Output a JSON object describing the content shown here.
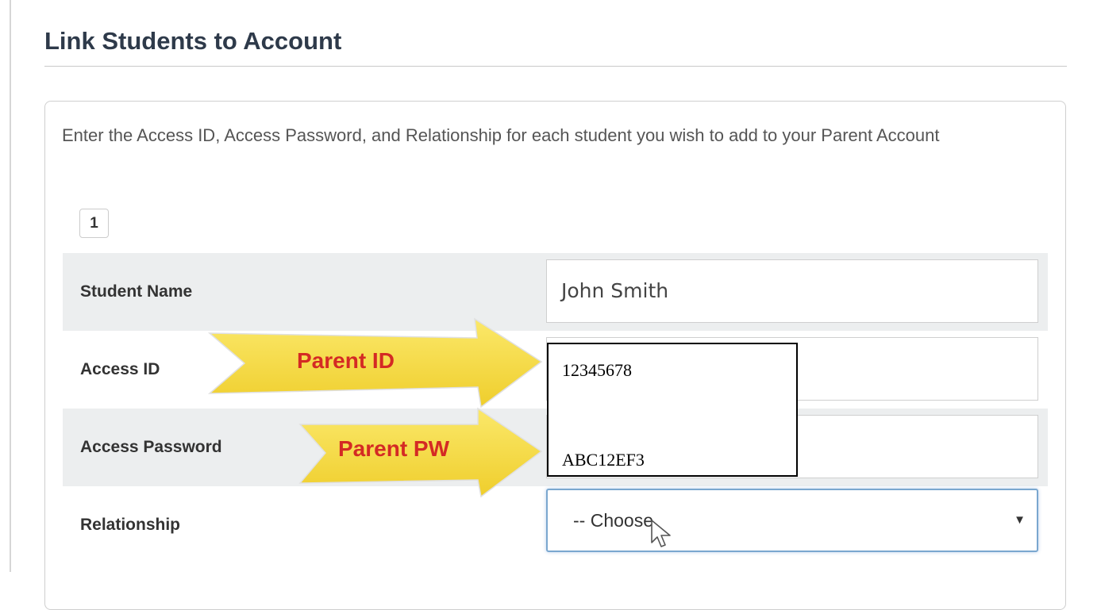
{
  "page": {
    "title": "Link Students to Account",
    "instructions": "Enter the Access ID, Access Password, and Relationship for each student you wish to add to your Parent Account"
  },
  "form": {
    "step_number": "1",
    "rows": [
      {
        "label": "Student Name",
        "value": "John Smith"
      },
      {
        "label": "Access ID"
      },
      {
        "label": "Access Password"
      },
      {
        "label": "Relationship",
        "selected": "-- Choose",
        "caret": "▼"
      }
    ]
  },
  "annotations": {
    "arrow_parent_id": "Parent ID",
    "arrow_parent_pw": "Parent PW",
    "overlay_lines": [
      "12345678",
      "ABC12EF3"
    ]
  },
  "colors": {
    "arrow_fill": "#f5dc43",
    "arrow_text": "#d42a24",
    "row_shade": "#eceeef",
    "select_focus_border": "#7aa7cf"
  }
}
